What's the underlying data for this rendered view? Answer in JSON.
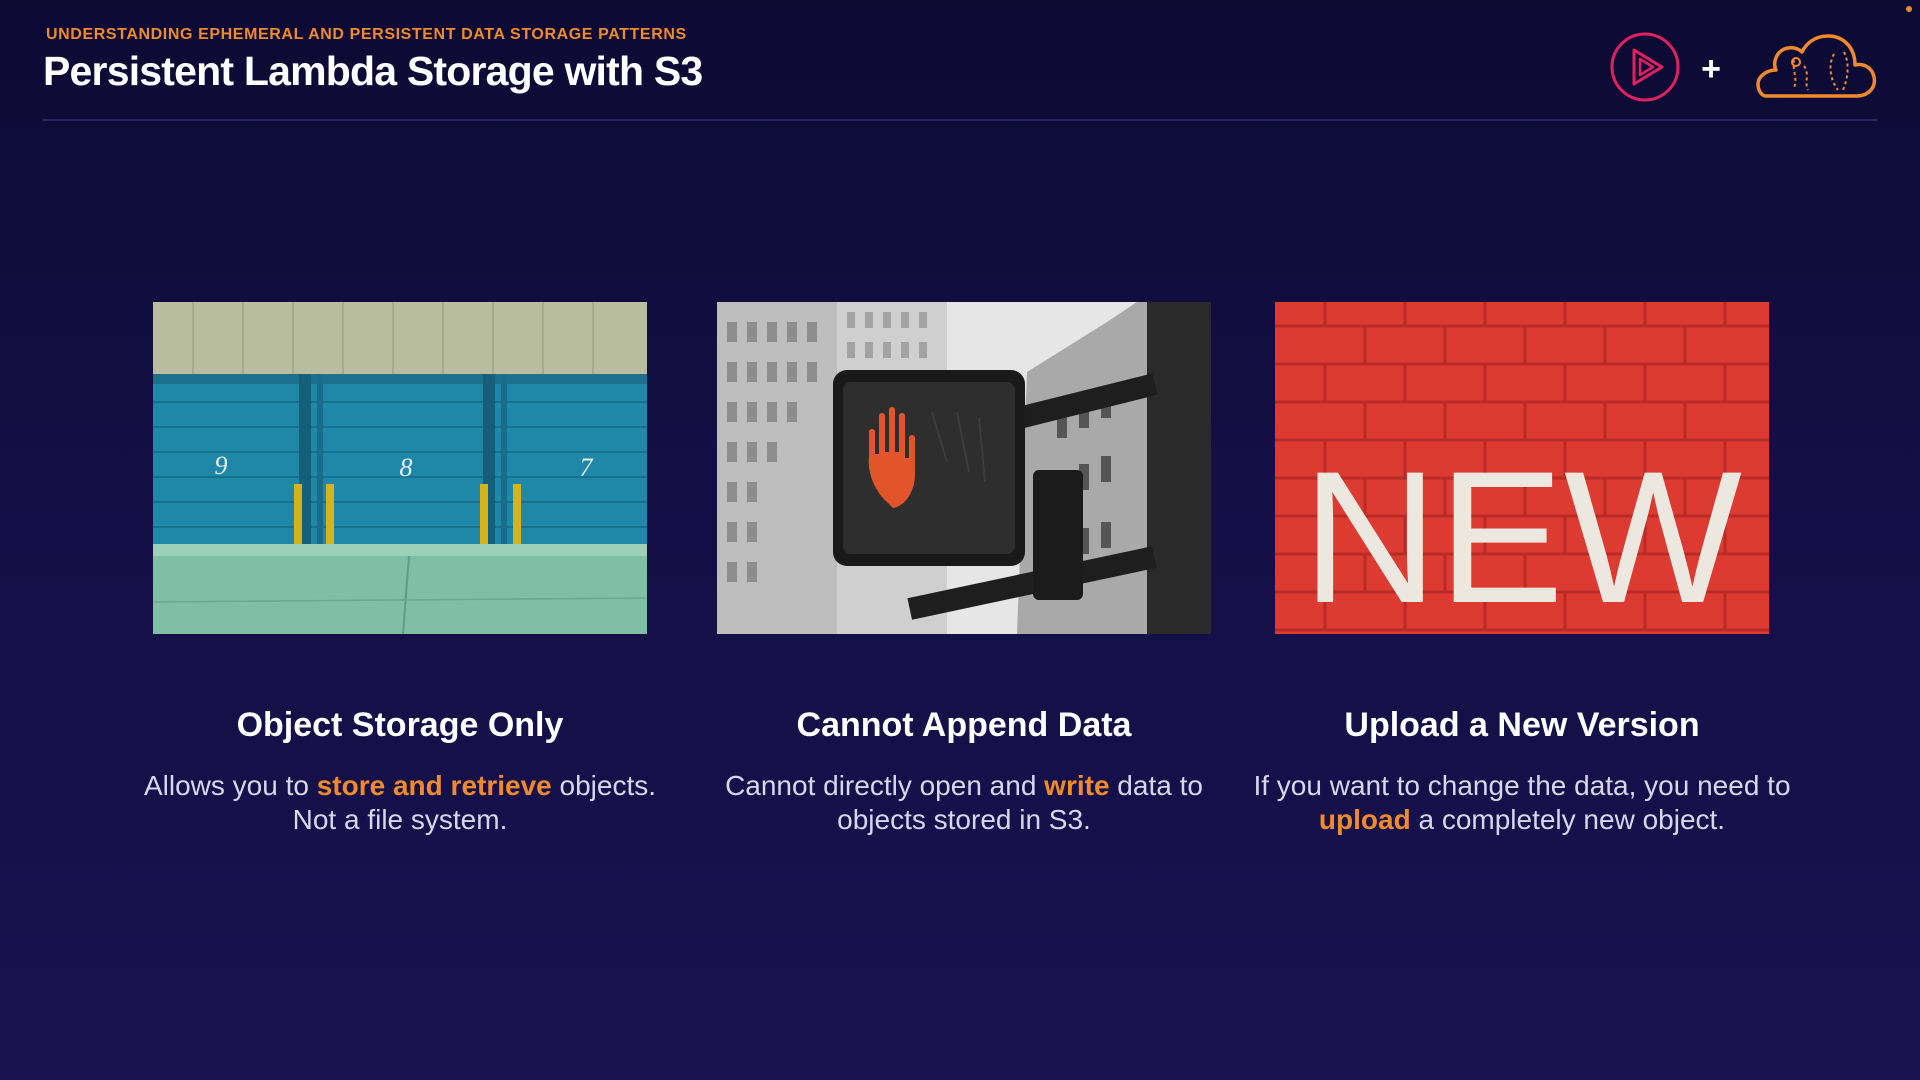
{
  "header": {
    "kicker": "UNDERSTANDING EPHEMERAL AND PERSISTENT DATA STORAGE PATTERNS",
    "title": "Persistent Lambda Storage with S3",
    "plus": "+"
  },
  "logos": {
    "left_icon": "play-circle-icon",
    "right_icon": "cloud-icon",
    "accent_pink": "#e0205f",
    "accent_orange": "#f08a2c"
  },
  "cards": [
    {
      "image": "storage-units-photo",
      "door_numbers": [
        "9",
        "8",
        "7"
      ],
      "heading": "Object Storage Only",
      "desc_pre": "Allows you to ",
      "desc_hl": "store and retrieve",
      "desc_post": " objects. Not a file system."
    },
    {
      "image": "crosswalk-signal-photo",
      "heading": "Cannot Append Data",
      "desc_pre": "Cannot directly open and ",
      "desc_hl": "write",
      "desc_post": " data to objects stored in S3."
    },
    {
      "image": "new-brick-wall-photo",
      "wall_text": "NEW",
      "heading": "Upload a New Version",
      "desc_pre": "If you want to change the data, you need to ",
      "desc_hl": "upload",
      "desc_post": " a completely new object."
    }
  ],
  "colors": {
    "background": "#140f45",
    "highlight": "#f08a2c",
    "body_text": "#d9d6ec"
  }
}
